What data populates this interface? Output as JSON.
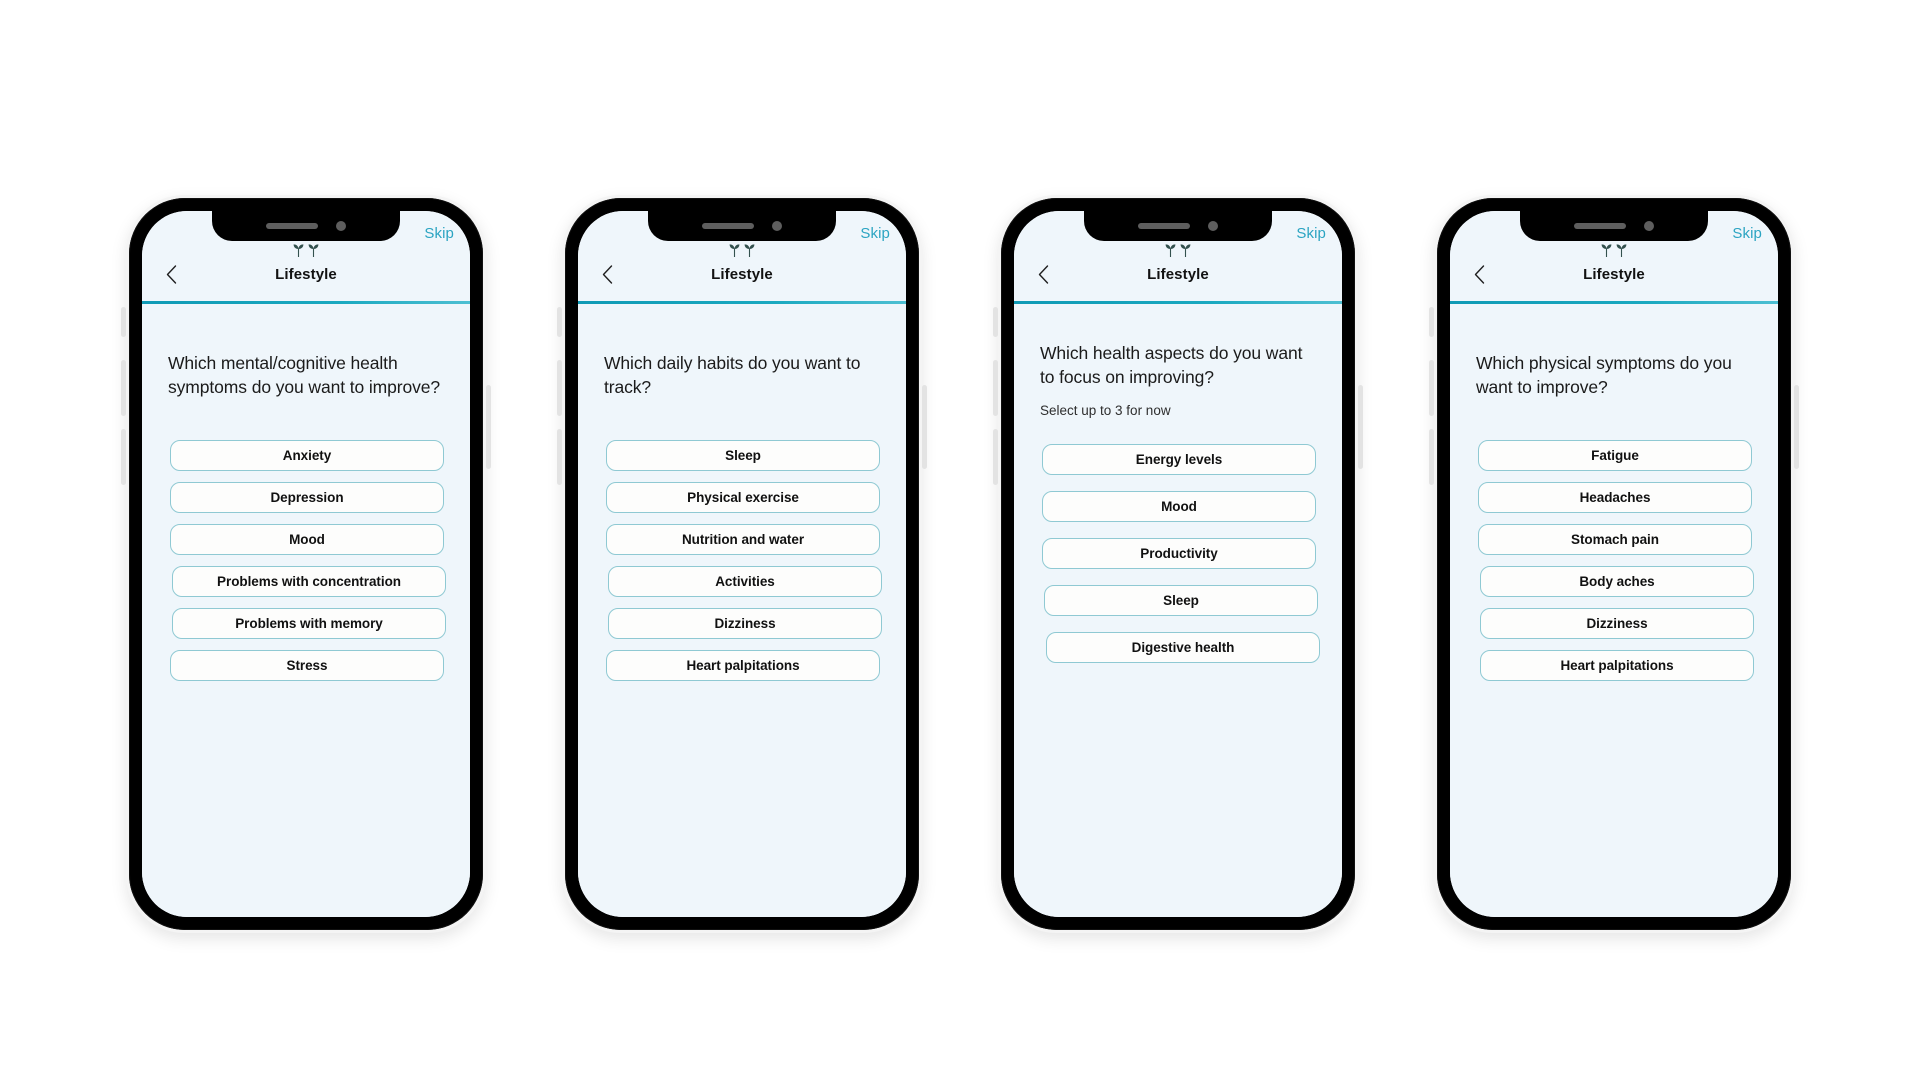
{
  "app": {
    "nav_title": "Lifestyle",
    "skip_label": "Skip",
    "back_icon": "chevron-left-icon",
    "sprout_icon": "sprout-pair-icon",
    "accent_color": "#2ba4c2",
    "progress_color": "#0f9ab5",
    "screen_bg": "#eff6fb",
    "pill_border": "#8fc9d3",
    "pill_bg": "#fdfdfc"
  },
  "screens": [
    {
      "nav_title": "Lifestyle",
      "skip_label": "Skip",
      "question": "Which mental/cognitive health symptoms do you want to improve?",
      "subtitle": "",
      "options": [
        "Anxiety",
        "Depression",
        "Mood",
        "Problems with concentration",
        "Problems with memory",
        "Stress"
      ]
    },
    {
      "nav_title": "Lifestyle",
      "skip_label": "Skip",
      "question": "Which daily habits do you want to track?",
      "subtitle": "",
      "options": [
        "Sleep",
        "Physical exercise",
        "Nutrition and water",
        "Activities",
        "Dizziness",
        "Heart palpitations"
      ]
    },
    {
      "nav_title": "Lifestyle",
      "skip_label": "Skip",
      "question": "Which health aspects do you want to focus on improving?",
      "subtitle": "Select up to 3 for now",
      "options": [
        "Energy levels",
        "Mood",
        "Productivity",
        "Sleep",
        "Digestive health"
      ]
    },
    {
      "nav_title": "Lifestyle",
      "skip_label": "Skip",
      "question": "Which physical symptoms do you want to improve?",
      "subtitle": "",
      "options": [
        "Fatigue",
        "Headaches",
        "Stomach pain",
        "Body aches",
        "Dizziness",
        "Heart palpitations"
      ]
    }
  ]
}
